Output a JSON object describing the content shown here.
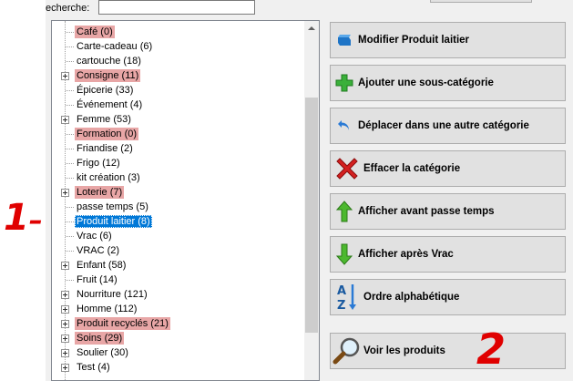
{
  "search": {
    "label": "echerche:",
    "value": ""
  },
  "tree": {
    "items": [
      {
        "label": "Café (0)",
        "highlight": true,
        "expandable": false
      },
      {
        "label": "Carte-cadeau (6)",
        "highlight": false,
        "expandable": false
      },
      {
        "label": "cartouche (18)",
        "highlight": false,
        "expandable": false
      },
      {
        "label": "Consigne (11)",
        "highlight": true,
        "expandable": true
      },
      {
        "label": "Épicerie (33)",
        "highlight": false,
        "expandable": false
      },
      {
        "label": "Événement (4)",
        "highlight": false,
        "expandable": false
      },
      {
        "label": "Femme (53)",
        "highlight": false,
        "expandable": true
      },
      {
        "label": "Formation (0)",
        "highlight": true,
        "expandable": false
      },
      {
        "label": "Friandise (2)",
        "highlight": false,
        "expandable": false
      },
      {
        "label": "Frigo (12)",
        "highlight": false,
        "expandable": false
      },
      {
        "label": "kit création (3)",
        "highlight": false,
        "expandable": false
      },
      {
        "label": "Loterie  (7)",
        "highlight": true,
        "expandable": true
      },
      {
        "label": "passe temps (5)",
        "highlight": false,
        "expandable": false
      },
      {
        "label": "Produit laitier (8)",
        "highlight": false,
        "expandable": false,
        "selected": true
      },
      {
        "label": "Vrac (6)",
        "highlight": false,
        "expandable": false
      },
      {
        "label": "VRAC (2)",
        "highlight": false,
        "expandable": false
      },
      {
        "label": "Enfant (58)",
        "highlight": false,
        "expandable": true
      },
      {
        "label": "Fruit (14)",
        "highlight": false,
        "expandable": false
      },
      {
        "label": "Nourriture (121)",
        "highlight": false,
        "expandable": true
      },
      {
        "label": "Homme (112)",
        "highlight": false,
        "expandable": true
      },
      {
        "label": "Produit recyclés (21)",
        "highlight": true,
        "expandable": true
      },
      {
        "label": "Soins (29)",
        "highlight": true,
        "expandable": true
      },
      {
        "label": "Soulier (30)",
        "highlight": false,
        "expandable": true
      },
      {
        "label": "Test (4)",
        "highlight": false,
        "expandable": true
      }
    ]
  },
  "actions": [
    {
      "label": "Modifier Produit laitier",
      "icon": "edit-icon",
      "name": "modify-product-button"
    },
    {
      "label": "Ajouter une sous-catégorie",
      "icon": "plus-icon",
      "name": "add-subcategory-button"
    },
    {
      "label": "Déplacer dans une autre catégorie",
      "icon": "move-icon",
      "name": "move-category-button"
    },
    {
      "label": "Effacer la catégorie",
      "icon": "delete-x-icon",
      "name": "delete-category-button"
    },
    {
      "label": "Afficher avant passe temps",
      "icon": "arrow-up-icon",
      "name": "show-before-button"
    },
    {
      "label": "Afficher après Vrac",
      "icon": "arrow-down-icon",
      "name": "show-after-button"
    },
    {
      "label": "Ordre alphabétique",
      "icon": "sort-az-icon",
      "name": "alphabetical-order-button"
    },
    {
      "label": "Voir les produits",
      "icon": "magnifier-icon",
      "name": "view-products-button"
    }
  ],
  "annotations": {
    "one": "1",
    "two": "2"
  },
  "colors": {
    "highlight": "#e8a6a6",
    "selected": "#0078d7",
    "annotation": "#e00000"
  }
}
